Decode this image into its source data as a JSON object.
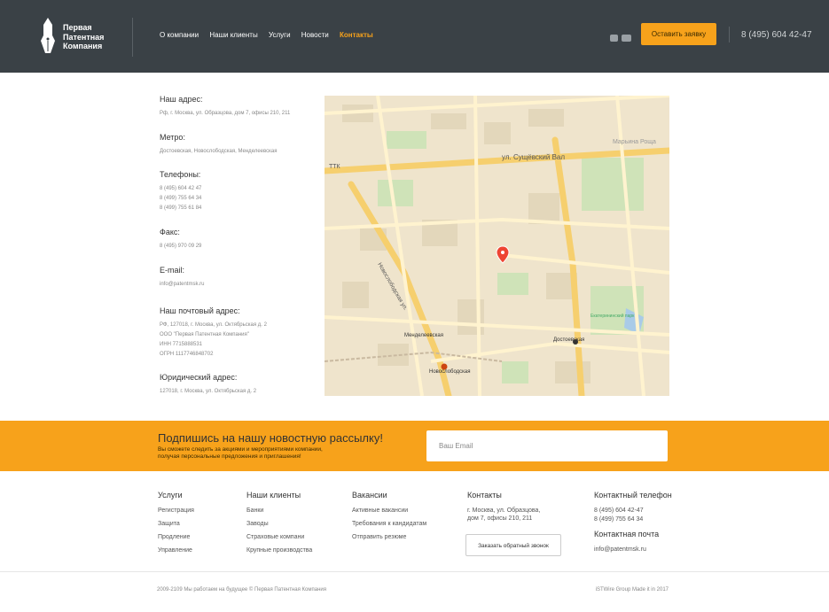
{
  "header": {
    "logo_lines": [
      "Первая",
      "Патентная",
      "Компания"
    ],
    "nav": [
      "О компании",
      "Наши клиенты",
      "Услуги",
      "Новости",
      "Контакты"
    ],
    "nav_active_index": 4,
    "cta": "Оставить заявку",
    "phone": "8 (495) 604 42-47"
  },
  "contacts": {
    "address_label": "Наш адрес:",
    "address": "Рф, г. Москва, ул. Образцова, дом 7, офисы 210, 211",
    "metro_label": "Метро:",
    "metro": "Достоевская, Новослободская, Менделеевская",
    "phones_label": "Телефоны:",
    "phones": [
      "8 (495) 604 42 47",
      "8 (499) 755 64 34",
      "8 (499) 755 61 84"
    ],
    "fax_label": "Факс:",
    "fax": "8 (495) 970 09 29",
    "email_label": "E-mail:",
    "email": "info@patentmsk.ru",
    "postal_label": "Наш почтовый адрес:",
    "postal": [
      "РФ, 127018, г. Москва, ул. Октябрьская д. 2",
      "ООО \"Первая Патентная Компания\"",
      "ИНН 7715888531",
      "ОГРН 1117746848702"
    ],
    "legal_label": "Юридический адрес:",
    "legal": "127018, г. Москва, ул. Октябрьская д. 2"
  },
  "subscribe": {
    "title": "Подпишись на нашу новостную рассылку!",
    "text_lines": [
      "Вы сможете следить за акциями и мероприятиями компании,",
      "получая персональные предложения и приглашения!"
    ],
    "placeholder": "Ваш Email"
  },
  "footer": {
    "cols": [
      {
        "title": "Услуги",
        "items": [
          "Регистрация",
          "Защита",
          "Продление",
          "Управление"
        ]
      },
      {
        "title": "Наши клиенты",
        "items": [
          "Банки",
          "Заводы",
          "Страховые компани",
          "Крупные производства"
        ]
      },
      {
        "title": "Вакансии",
        "items": [
          "Активные вакансии",
          "Требования к кандидатам",
          "Отправить резюме"
        ]
      }
    ],
    "contacts_title": "Контакты",
    "contacts_address": [
      "г. Москва, ул. Образцова,",
      "дом 7, офисы 210, 211"
    ],
    "callback": "Заказать обратный звонок",
    "phone_title": "Контактный телефон",
    "phones": [
      "8 (495) 604 42-47",
      "8 (499) 755 64 34"
    ],
    "mail_title": "Контактная почта",
    "mail": "info@patentmsk.ru",
    "copyright": "2009-2109 Мы работаем на будущее © Первая Патентная Компания",
    "credits": "iSTWire Group Made it in 2017"
  },
  "map_labels": {
    "street": "ул. Сущёвский Вал",
    "metro1": "Менделеевская",
    "metro2": "Новослободская",
    "metro3": "Достоевская",
    "ttk": "ТТК",
    "street2": "Новослободская ул.",
    "area": "Марьина Роща",
    "park": "Екатерининский парк"
  },
  "colors": {
    "header_bg": "#3a4146",
    "accent": "#f7a21b"
  }
}
